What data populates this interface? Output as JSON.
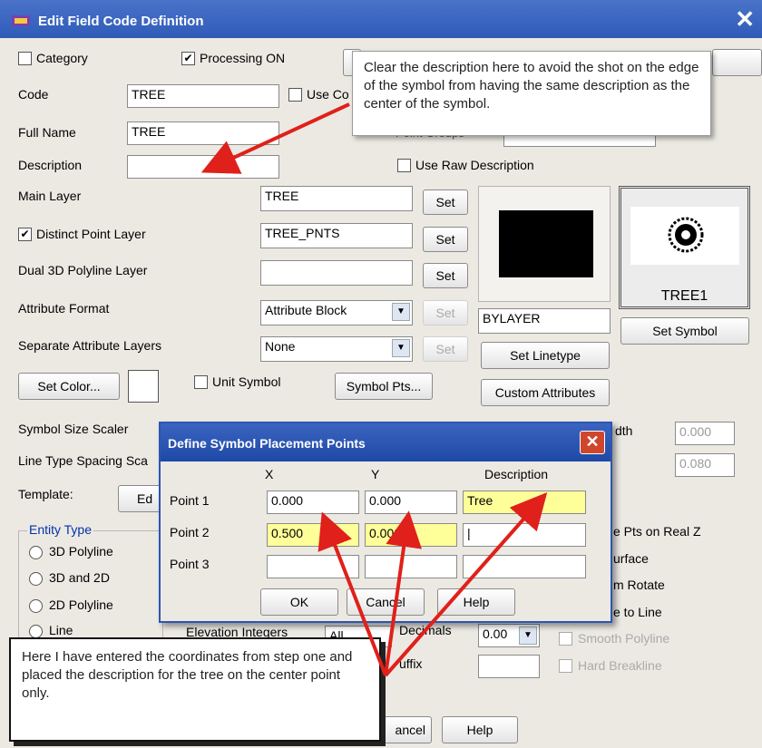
{
  "window": {
    "title": "Edit Field Code Definition",
    "close": "✕"
  },
  "top": {
    "category": "Category",
    "processing": "Processing ON",
    "processing_mark": "✔"
  },
  "labels": {
    "code": "Code",
    "full_name": "Full Name",
    "description": "Description",
    "main_layer": "Main Layer",
    "distinct_point_layer": "Distinct Point Layer",
    "dual_3d": "Dual 3D Polyline Layer",
    "attribute_format": "Attribute Format",
    "separate_attr": "Separate Attribute Layers",
    "symbol_size": "Symbol Size Scaler",
    "line_type_spacing": "Line Type Spacing Sca",
    "template": "Template:",
    "use_co": "Use Co",
    "point_groups": "Point Groups",
    "use_raw": "Use Raw Description",
    "unit_symbol": "Unit Symbol",
    "width_partial": "dth",
    "distinct_mark": "✔"
  },
  "values": {
    "code": "TREE",
    "full_name": "TREE",
    "description": "",
    "main_layer": "TREE",
    "distinct_layer": "TREE_PNTS",
    "dual_3d": "",
    "attribute_format": "Attribute Block",
    "separate_attr": "None",
    "linetype": "BYLAYER",
    "width": "0.000",
    "spacing": "0.080",
    "decimals": "0.00"
  },
  "buttons": {
    "set": "Set",
    "set_linetype": "Set Linetype",
    "custom_attributes": "Custom Attributes",
    "set_symbol": "Set Symbol",
    "set_color": "Set Color...",
    "symbol_pts": "Symbol Pts...",
    "edit_partial": "Ed",
    "cancel_partial": "ancel",
    "help": "Help"
  },
  "symbol": {
    "name": "TREE1"
  },
  "entity": {
    "title": "Entity Type",
    "options": [
      "3D Polyline",
      "3D and 2D",
      "2D Polyline",
      "Line"
    ]
  },
  "right_opts": [
    "e Pts on Real Z",
    "urface",
    "m Rotate",
    "e to Line"
  ],
  "bottom": {
    "elevation_integers": "Elevation Integers",
    "all": "All",
    "decimals_label": "Decimals",
    "suffix": "uffix",
    "smooth_polyline": "Smooth Polyline",
    "hard_breakline": "Hard Breakline"
  },
  "dialog": {
    "title": "Define Symbol Placement Points",
    "close": "✕",
    "headers": {
      "x": "X",
      "y": "Y",
      "description": "Description"
    },
    "rows": [
      {
        "label": "Point 1",
        "x": "0.000",
        "y": "0.000",
        "desc": "Tree"
      },
      {
        "label": "Point 2",
        "x": "0.500",
        "y": "0.000",
        "desc": "|"
      },
      {
        "label": "Point 3",
        "x": "",
        "y": "",
        "desc": ""
      }
    ],
    "ok": "OK",
    "cancel": "Cancel",
    "help": "Help"
  },
  "callouts": {
    "top": "Clear the description here to avoid the shot on the edge of the symbol from having the same description as the center of the symbol.",
    "bottom": "Here I have entered the coordinates from step one and placed the description for the tree on the center point only."
  },
  "colors": {
    "titlebar": "#2f5bb8",
    "highlight": "#ffff99",
    "arrow": "#e0201a",
    "window_bg": "#ece9e3"
  }
}
